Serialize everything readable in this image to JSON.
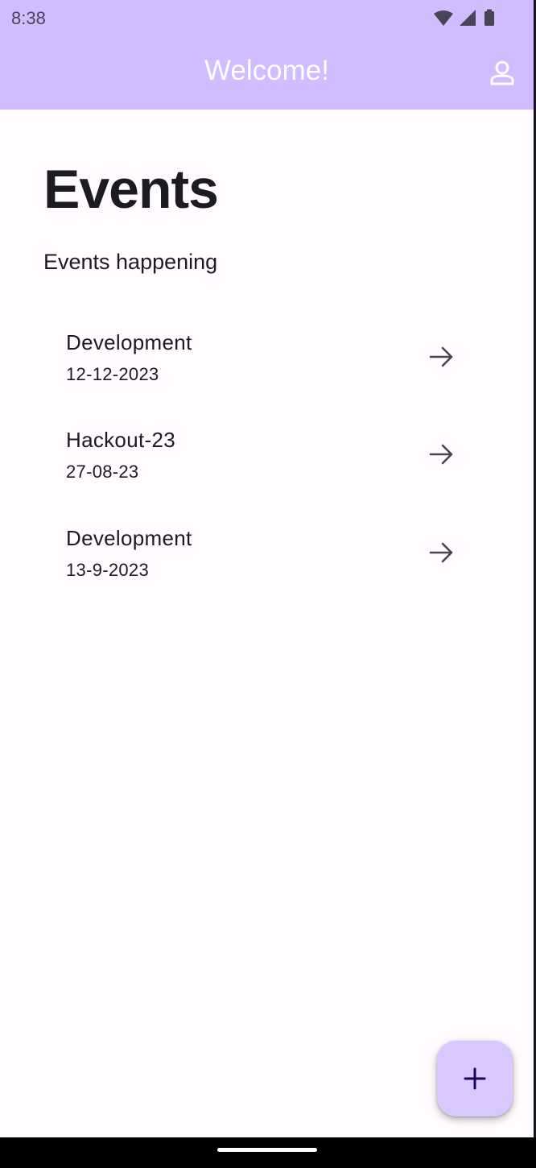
{
  "status_bar": {
    "time": "8:38",
    "icons": [
      "wifi-icon",
      "signal-icon",
      "battery-icon"
    ]
  },
  "app_bar": {
    "title": "Welcome!",
    "profile_icon": "person-icon",
    "background": "#d0bcff"
  },
  "main": {
    "title": "Events",
    "subtitle": "Events happening",
    "events": [
      {
        "name": "Development",
        "date": "12-12-2023",
        "icon": "arrow-right-icon"
      },
      {
        "name": "Hackout-23",
        "date": "27-08-23",
        "icon": "arrow-right-icon"
      },
      {
        "name": "Development",
        "date": "13-9-2023",
        "icon": "arrow-right-icon"
      }
    ]
  },
  "fab": {
    "icon": "plus-icon",
    "color": "#d9c8ff"
  }
}
